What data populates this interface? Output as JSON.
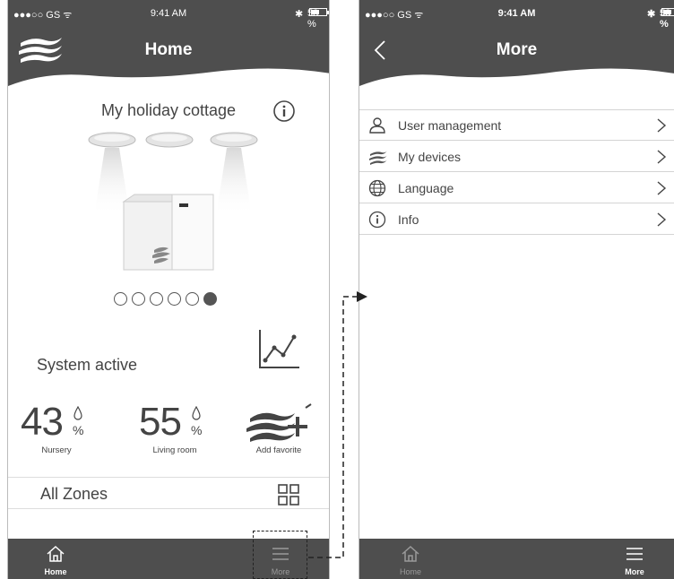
{
  "colors": {
    "header": "#4e4e4e",
    "tabbar": "#4e4e4e",
    "text": "#444444",
    "tab_active": "#ffffff",
    "tab_inactive": "#9a9a9a"
  },
  "status_bar": {
    "carrier": "●●●○○ GS ᯤ",
    "time": "9:41 AM",
    "bluetooth": "✱",
    "battery": "58 %"
  },
  "home": {
    "title": "Home",
    "place_name": "My holiday cottage",
    "carousel": {
      "total": 6,
      "active_index": 5
    },
    "system_status": "System active",
    "readings": [
      {
        "value": "43",
        "unit": "%",
        "label": "Nursery"
      },
      {
        "value": "55",
        "unit": "%",
        "label": "Living room"
      }
    ],
    "add_favorite_label": "Add favorite",
    "zones_label": "All Zones",
    "tabs": [
      {
        "label": "Home",
        "icon": "home-icon",
        "active": true
      },
      {
        "label": "More",
        "icon": "menu-icon",
        "active": false
      }
    ]
  },
  "more": {
    "title": "More",
    "items": [
      {
        "label": "User management",
        "icon": "user-icon"
      },
      {
        "label": "My devices",
        "icon": "brand-logo-icon"
      },
      {
        "label": "Language",
        "icon": "globe-icon"
      },
      {
        "label": "Info",
        "icon": "info-icon"
      }
    ],
    "tabs": [
      {
        "label": "Home",
        "icon": "home-icon",
        "active": false
      },
      {
        "label": "More",
        "icon": "menu-icon",
        "active": true
      }
    ]
  }
}
